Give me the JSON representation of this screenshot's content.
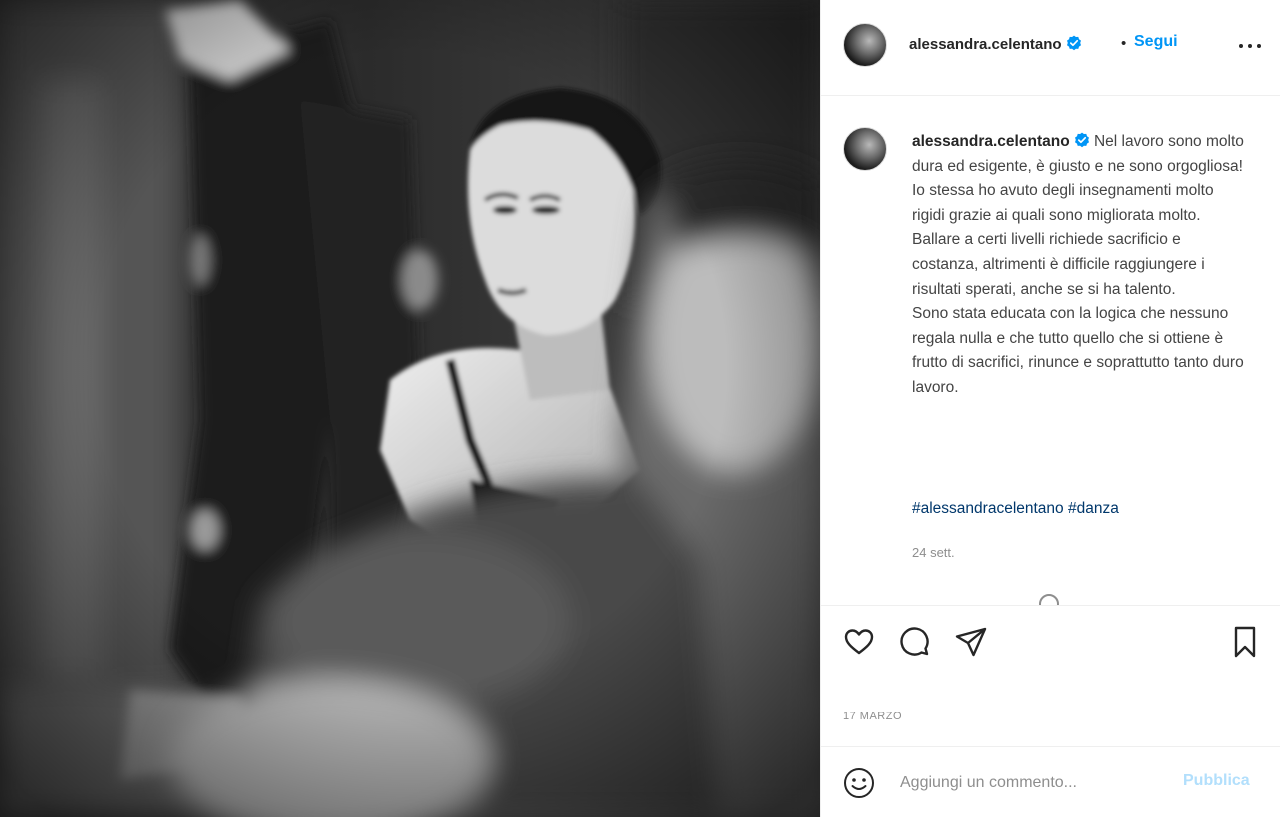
{
  "colors": {
    "accent": "#0095f6",
    "hashtag": "#00376b",
    "muted": "#8e8e8e",
    "publish_disabled": "#b2dffc"
  },
  "header": {
    "username": "alessandra.celentano",
    "separator": "•",
    "follow_label": "Segui",
    "more_icon": "more-horizontal-icon"
  },
  "caption": {
    "username": "alessandra.celentano",
    "text": "Nel lavoro sono molto dura ed esigente, è giusto e ne sono orgogliosa! Io stessa ho avuto degli insegnamenti molto rigidi grazie ai quali sono migliorata molto. Ballare a certi livelli richiede sacrificio e costanza, altrimenti è difficile raggiungere i risultati sperati, anche se si ha talento.\nSono stata educata con la logica che nessuno regala nulla e che tutto quello che si ottiene è frutto di sacrifici, rinunce e soprattutto tanto duro lavoro.",
    "hashtags": [
      "#alessandracelentano",
      "#danza"
    ],
    "time": "24 sett."
  },
  "actions": {
    "icons": [
      "heart-icon",
      "comment-icon",
      "share-icon",
      "bookmark-icon"
    ]
  },
  "post_date": "17 MARZO",
  "comment": {
    "placeholder": "Aggiungi un commento...",
    "publish_label": "Pubblica"
  }
}
